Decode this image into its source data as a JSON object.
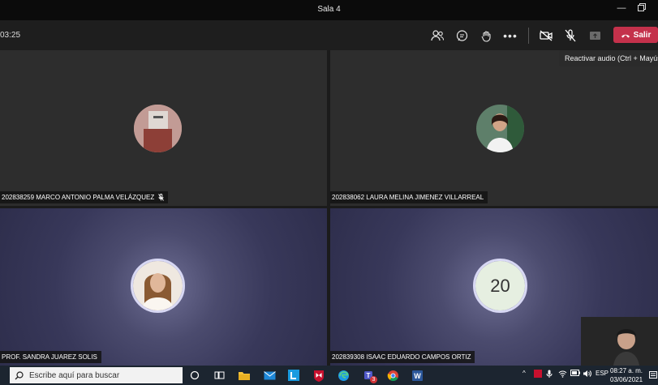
{
  "window": {
    "title": "Sala 4"
  },
  "toolbar": {
    "timer": "03:25",
    "leave_label": "Salir",
    "tooltip": "Reactivar audio (Ctrl + Mayús"
  },
  "participants": [
    {
      "name": "202838259 MARCO ANTONIO PALMA VELÁZQUEZ",
      "muted": true
    },
    {
      "name": "202838062 LAURA MELINA JIMENEZ VILLARREAL",
      "muted": false
    },
    {
      "name": "PROF. SANDRA JUAREZ SOLIS",
      "muted": false
    },
    {
      "name": "202839308 ISAAC EDUARDO CAMPOS ORTIZ",
      "muted": false,
      "initials": "20"
    }
  ],
  "taskbar": {
    "search_placeholder": "Escribe aquí para buscar",
    "lang": "ESP",
    "time": "08:27 a. m.",
    "date": "03/06/2021",
    "teams_badge": "3"
  },
  "colors": {
    "leave": "#c4314b",
    "tile_dark": "#2d2d2d",
    "tile_blue": "#38385a",
    "taskbar": "#1c2530"
  }
}
